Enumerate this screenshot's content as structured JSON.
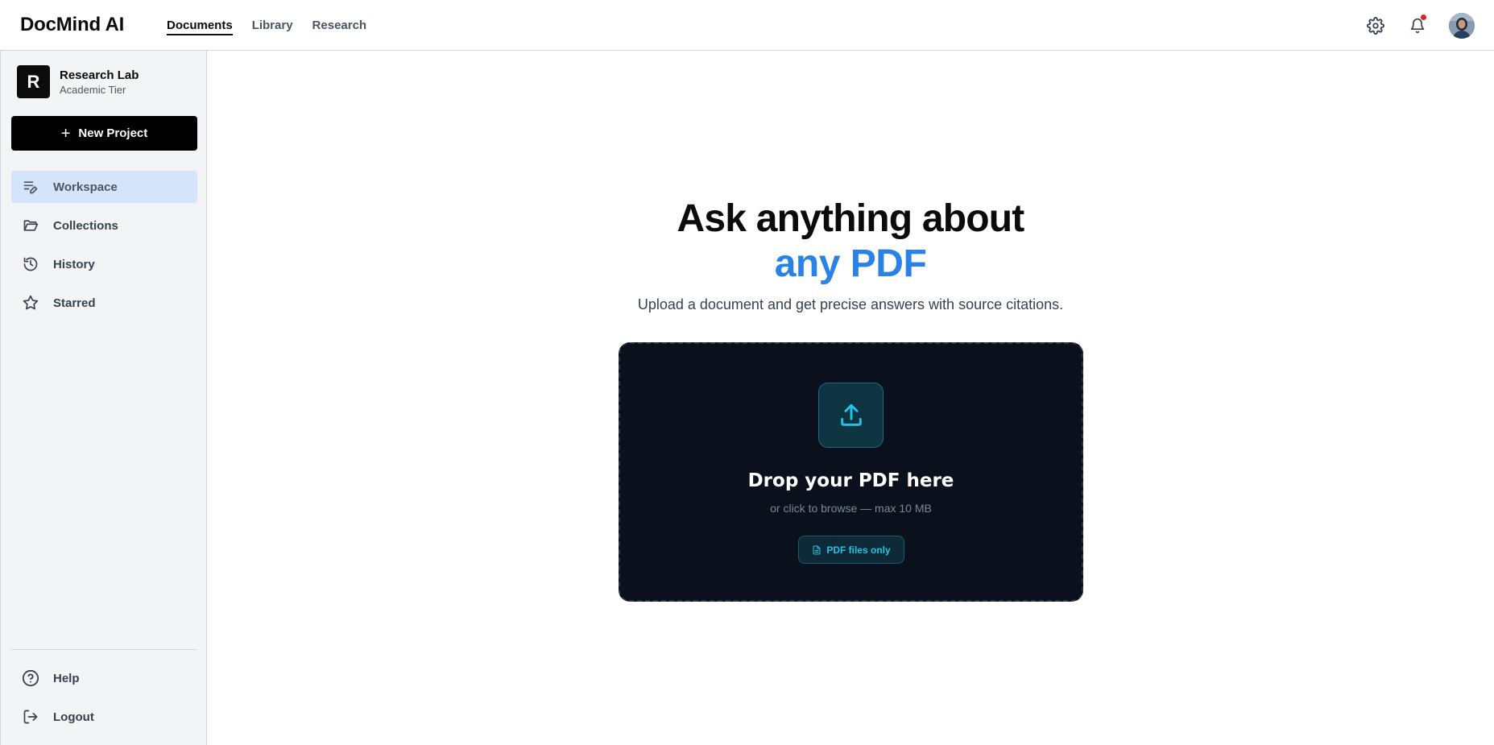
{
  "app": {
    "title": "DocMind AI"
  },
  "topnav": {
    "items": [
      {
        "label": "Documents",
        "active": true
      },
      {
        "label": "Library",
        "active": false
      },
      {
        "label": "Research",
        "active": false
      }
    ]
  },
  "header_icons": {
    "settings": "gear-icon",
    "notifications": "bell-icon",
    "notification_dot_color": "#dc2626"
  },
  "sidebar": {
    "org": {
      "initial": "R",
      "name": "Research Lab",
      "tier": "Academic Tier"
    },
    "new_project_label": "New Project",
    "items": [
      {
        "label": "Workspace",
        "icon": "edit-list-icon",
        "active": true
      },
      {
        "label": "Collections",
        "icon": "folder-icon",
        "active": false
      },
      {
        "label": "History",
        "icon": "history-icon",
        "active": false
      },
      {
        "label": "Starred",
        "icon": "star-icon",
        "active": false
      }
    ],
    "bottom_items": [
      {
        "label": "Help",
        "icon": "help-icon"
      },
      {
        "label": "Logout",
        "icon": "logout-icon"
      }
    ]
  },
  "main": {
    "headline_line1": "Ask anything about",
    "headline_line2": "any PDF",
    "subtitle": "Upload a document and get precise answers with source citations.",
    "dropzone": {
      "title": "Drop your PDF here",
      "subtitle": "or click to browse — max 10 MB",
      "pill": "PDF files only"
    }
  },
  "colors": {
    "accent": "#2b82e6",
    "dropzone_bg": "#0b111c",
    "cyan": "#22c5e6"
  }
}
